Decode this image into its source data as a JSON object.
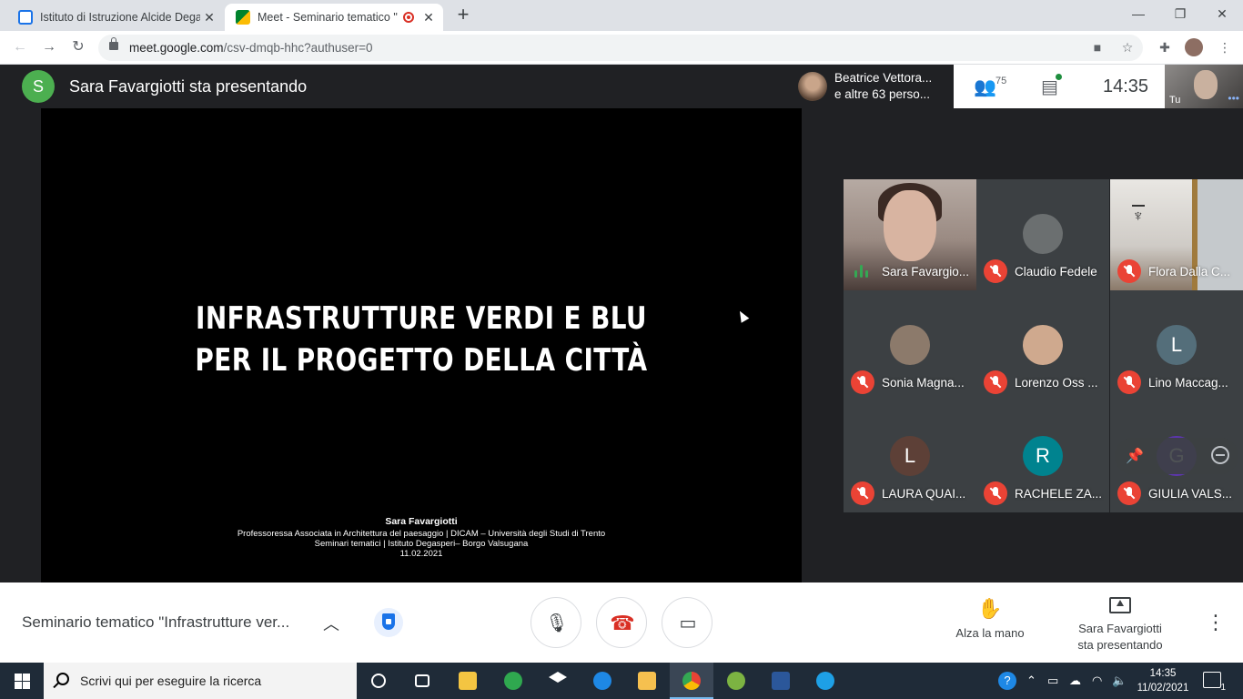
{
  "browser": {
    "tabs": [
      {
        "title": "Istituto di Istruzione Alcide Dega",
        "active": false,
        "favicon": "google-calendar-icon"
      },
      {
        "title": "Meet - Seminario tematico \"I",
        "active": true,
        "favicon": "google-meet-icon",
        "recording": true
      }
    ],
    "url_host": "meet.google.com",
    "url_path": "/csv-dmqb-hhc?authuser=0"
  },
  "meet": {
    "presenter_initial": "S",
    "presenter_banner": "Sara Favargiotti sta presentando",
    "participants_preview_line1": "Beatrice Vettora...",
    "participants_preview_line2": "e altre 63 perso...",
    "participant_count": "75",
    "clock": "14:35",
    "self_label": "Tu",
    "slide": {
      "title_line1": "INFRASTRUTTURE VERDI E BLU",
      "title_line2": "PER IL PROGETTO DELLA CITTÀ",
      "author": "Sara Favargiotti",
      "affiliation": "Professoressa Associata in Architettura del paesaggio | DICAM – Università degli Studi di Trento",
      "series": "Seminari tematici | Istituto Degasperi– Borgo Valsugana",
      "date": "11.02.2021"
    },
    "tiles": [
      {
        "name": "Sara Favargio...",
        "initial": "",
        "color": "",
        "speaking": true
      },
      {
        "name": "Claudio Fedele",
        "initial": "",
        "color": "#6b6f70",
        "muted": true
      },
      {
        "name": "Flora Dalla C...",
        "initial": "",
        "color": "",
        "muted": true
      },
      {
        "name": "Sonia Magna...",
        "initial": "",
        "color": "#8c7a6b",
        "muted": true
      },
      {
        "name": "Lorenzo Oss ...",
        "initial": "",
        "color": "#cfa98e",
        "muted": true
      },
      {
        "name": "Lino Maccag...",
        "initial": "L",
        "color": "#546e7a",
        "muted": true
      },
      {
        "name": "LAURA QUAI...",
        "initial": "L",
        "color": "#5d4037",
        "muted": true
      },
      {
        "name": "RACHELE ZA...",
        "initial": "R",
        "color": "#00838f",
        "muted": true
      },
      {
        "name": "GIULIA VALS...",
        "initial": "G",
        "color": "#5e35b1",
        "muted": true
      }
    ]
  },
  "controls": {
    "meeting_title": "Seminario tematico \"Infrastrutture ver...",
    "raise_hand_label": "Alza la mano",
    "presenting_line1": "Sara Favargiotti",
    "presenting_line2": "sta presentando"
  },
  "taskbar": {
    "search_placeholder": "Scrivi qui per eseguire la ricerca",
    "time": "14:35",
    "date": "11/02/2021",
    "notifications": "1"
  },
  "colors": {
    "meet_bg": "#202124",
    "accent": "#1a73e8",
    "muted_red": "#ea4335",
    "speaking_green": "#34a853"
  }
}
